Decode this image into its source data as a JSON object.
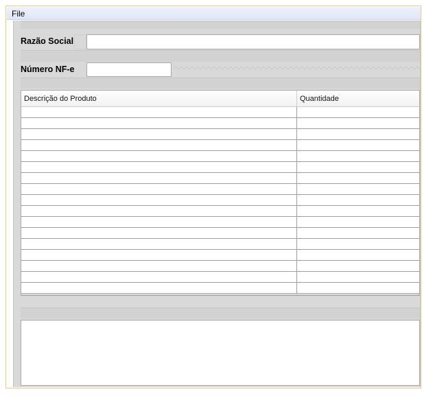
{
  "menu": {
    "file_label": "File"
  },
  "form": {
    "razao_social": {
      "label": "Razão Social",
      "value": ""
    },
    "numero_nfe": {
      "label": "Número NF-e",
      "value": ""
    }
  },
  "table": {
    "columns": [
      "Descrição do Produto",
      "Quantidade"
    ],
    "row_count": 17
  },
  "notes": {
    "value": ""
  },
  "colors": {
    "window_border": "#f2c88a",
    "panel_bg": "#d9d9d9",
    "menubar_bg": "#e4eaf7"
  }
}
